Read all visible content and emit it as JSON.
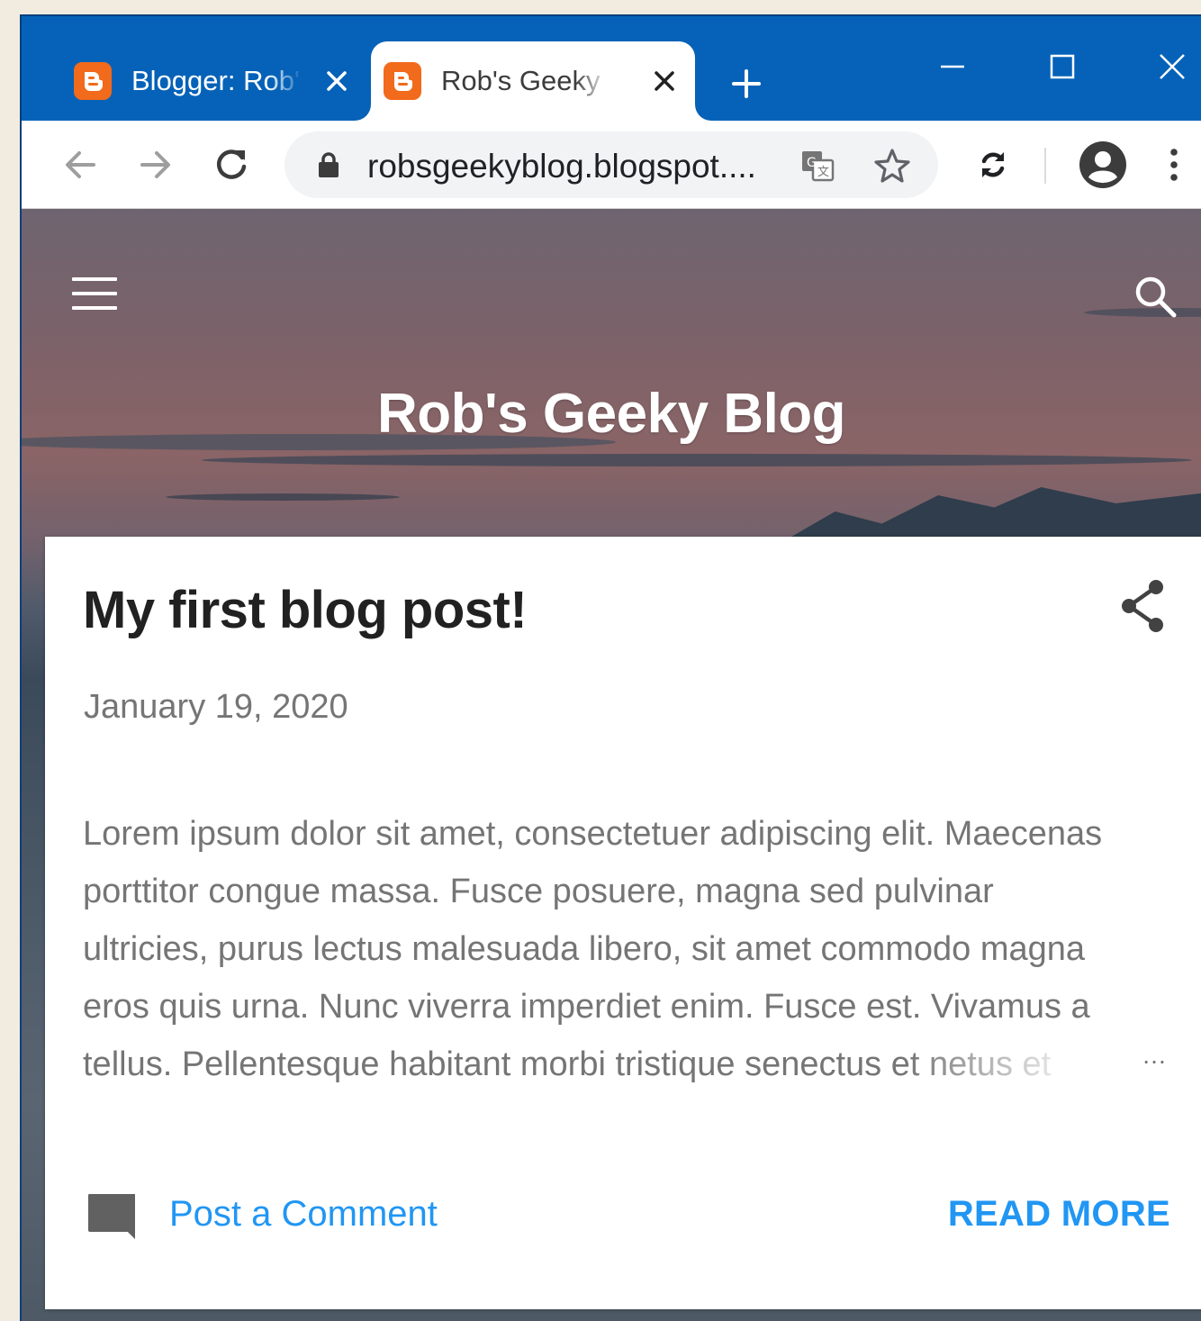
{
  "browser": {
    "tabs": [
      {
        "title": "Blogger: Rob's Geeky Blog",
        "active": false
      },
      {
        "title": "Rob's Geeky Blog",
        "active": true
      }
    ],
    "url": "robsgeekyblog.blogspot....",
    "accent": "#0562b8"
  },
  "blog": {
    "title": "Rob's Geeky Blog"
  },
  "post": {
    "title": "My first blog post!",
    "date": "January 19, 2020",
    "body_lines": [
      "Lorem ipsum dolor sit amet, consectetuer adipiscing elit. Maecenas",
      "porttitor congue massa. Fusce posuere, magna sed pulvinar",
      "ultricies, purus lectus malesuada libero, sit amet commodo magna",
      "eros quis urna. Nunc viverra imperdiet enim. Fusce est. Vivamus a",
      "tellus. Pellentesque habitant morbi tristique senectus et netus et"
    ],
    "ellipsis": "…",
    "comment_label": "Post a Comment",
    "read_more_label": "READ MORE",
    "link_color": "#2196f3"
  }
}
